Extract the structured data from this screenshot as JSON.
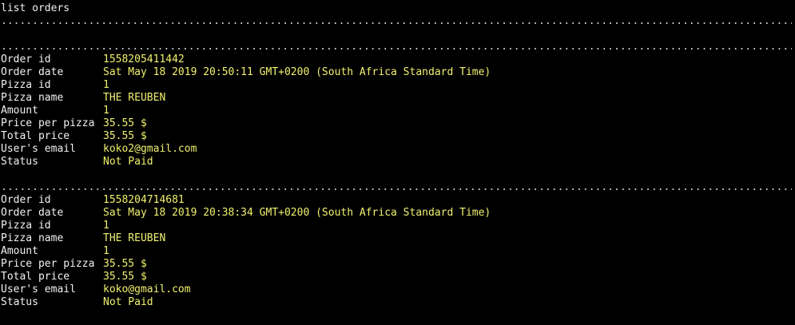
{
  "console": {
    "command": "list orders",
    "separator": ".....................................................................................................................................",
    "labels": {
      "order_id": "Order id",
      "order_date": "Order date",
      "pizza_id": "Pizza id",
      "pizza_name": "Pizza name",
      "amount": "Amount",
      "price_per_pizza": "Price per pizza",
      "total_price": "Total price",
      "email": "User's email",
      "status": "Status"
    },
    "orders": [
      {
        "order_id": "1558205411442",
        "order_date": "Sat May 18 2019 20:50:11 GMT+0200 (South Africa Standard Time)",
        "pizza_id": "1",
        "pizza_name": "THE REUBEN",
        "amount": "1",
        "price_per_pizza": "35.55 $",
        "total_price": "35.55 $",
        "email": "koko2@gmail.com",
        "status": "Not Paid"
      },
      {
        "order_id": "1558204714681",
        "order_date": "Sat May 18 2019 20:38:34 GMT+0200 (South Africa Standard Time)",
        "pizza_id": "1",
        "pizza_name": "THE REUBEN",
        "amount": "1",
        "price_per_pizza": "35.55 $",
        "total_price": "35.55 $",
        "email": "koko@gmail.com",
        "status": "Not Paid"
      }
    ]
  },
  "colors": {
    "background": "#000000",
    "text": "#f2f2f2",
    "value": "#f0f070"
  }
}
